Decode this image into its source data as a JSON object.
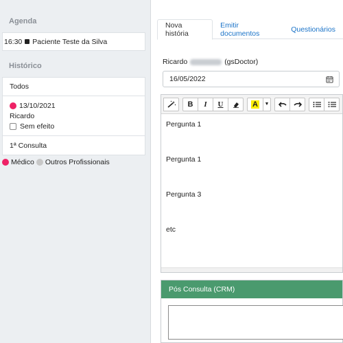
{
  "sidebar": {
    "agenda_title": "Agenda",
    "agenda_item": {
      "time": "16:30",
      "patient": "Paciente Teste da Silva"
    },
    "historico_title": "Histórico",
    "history": {
      "filter_all": "Todos",
      "entry": {
        "date": "13/10/2021",
        "author": "Ricardo",
        "checkbox_label": "Sem efeito"
      },
      "consulta_label": "1ª Consulta"
    },
    "legend": {
      "medico": "Médico",
      "outros": "Outros Profissionais"
    }
  },
  "tabs": [
    {
      "label": "Nova história",
      "active": true
    },
    {
      "label": "Emitir documentos",
      "active": false
    },
    {
      "label": "Questionários",
      "active": false
    }
  ],
  "author": {
    "first_name": "Ricardo",
    "suffix": "(gsDoctor)"
  },
  "date_field": {
    "value": "16/05/2022"
  },
  "editor": {
    "lines": [
      "Pergunta 1",
      "Pergunta 1",
      "Pergunta 3",
      "etc"
    ]
  },
  "pos_consulta": {
    "title": "Pós Consulta (CRM)",
    "value": ""
  },
  "colors": {
    "medico": "#ee2266",
    "outros": "#c8c8c8",
    "pos_header": "#4a9a6e",
    "link": "#1a73c8"
  },
  "icons": {
    "magic": "magic-wand-icon",
    "eraser": "eraser-icon",
    "undo": "undo-icon",
    "redo": "redo-icon",
    "ul": "unordered-list-icon",
    "ol": "ordered-list-icon",
    "calendar": "calendar-icon"
  }
}
